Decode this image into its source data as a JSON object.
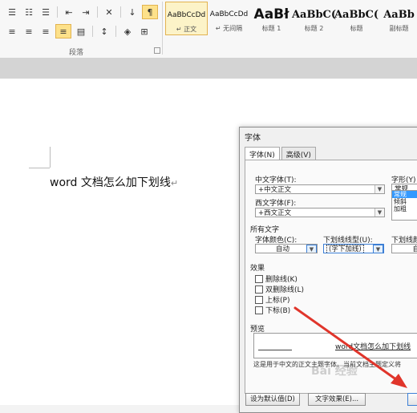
{
  "ribbon": {
    "row1_icons": [
      "bullet-list-icon",
      "numbered-list-icon",
      "multilevel-list-icon",
      "decrease-indent-icon",
      "increase-indent-icon",
      "chinese-layout-icon",
      "sort-icon",
      "show-marks-icon"
    ],
    "row2_icons": [
      "align-left-icon",
      "align-center-icon",
      "align-right-icon",
      "justify-icon",
      "distributed-icon",
      "line-spacing-icon",
      "shading-icon",
      "borders-icon"
    ],
    "group_label": "段落",
    "styles": [
      {
        "preview": "AaBbCcDd",
        "name": "↵ 正文"
      },
      {
        "preview": "AaBbCcDd",
        "name": "↵ 无间隔"
      },
      {
        "preview": "AaBł",
        "name": "标题 1"
      },
      {
        "preview": "AaBbC(",
        "name": "标题 2"
      },
      {
        "preview": "AaBbC(",
        "name": "标题"
      },
      {
        "preview": "AaBb",
        "name": "副标题"
      }
    ]
  },
  "document": {
    "text": "word 文档怎么加下划线",
    "paragraph_mark": "↵"
  },
  "dialog": {
    "title": "字体",
    "tabs": [
      "字体(N)",
      "高级(V)"
    ],
    "cn_font_label": "中文字体(T):",
    "cn_font_value": "+中文正文",
    "west_font_label": "西文字体(F):",
    "west_font_value": "+西文正文",
    "style_label": "字形(Y)",
    "style_value": "常规",
    "style_options": [
      "常规",
      "倾斜",
      "加粗"
    ],
    "all_text_label": "所有文字",
    "font_color_label": "字体颜色(C):",
    "font_color_value": "自动",
    "underline_type_label": "下划线线型(U):",
    "underline_type_value": "(字下加线)",
    "underline_color_label": "下划线颜",
    "underline_color_value": "自",
    "effects_label": "效果",
    "effects": [
      "删除线(K)",
      "双删除线(L)",
      "上标(P)",
      "下标(B)"
    ],
    "preview_label": "预览",
    "preview_text": "word文档怎么加下划线",
    "note": "这是用于中文的正文主题字体。当前文档主题定义将",
    "buttons": {
      "default": "设为默认值(D)",
      "text_effects": "文字效果(E)..."
    }
  },
  "watermark": "Bai 经验",
  "colors": {
    "accent": "#3c7fd6",
    "selected_style": "#fcf3c8",
    "arrow": "#e0352b"
  }
}
